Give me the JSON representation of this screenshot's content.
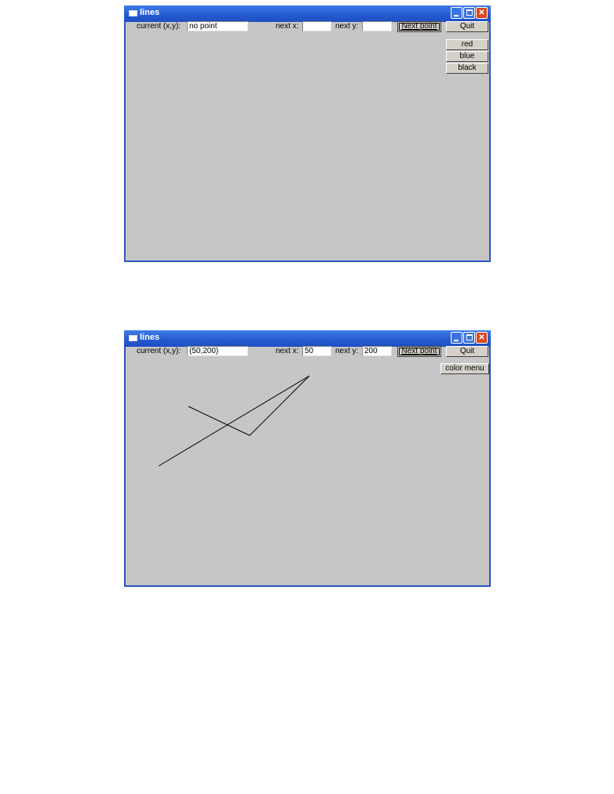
{
  "windows": [
    {
      "title": "lines",
      "current_label": "current (x,y):",
      "current_value": "no point",
      "next_x_label": "next x:",
      "next_x_value": "",
      "next_y_label": "next y:",
      "next_y_value": "",
      "next_point_label": "Next point",
      "quit_label": "Quit",
      "color_items": [
        "red",
        "blue",
        "black"
      ]
    },
    {
      "title": "lines",
      "current_label": "current (x,y):",
      "current_value": "(50,200)",
      "next_x_label": "next x:",
      "next_x_value": "50",
      "next_y_label": "next y:",
      "next_y_value": "200",
      "next_point_label": "Next point",
      "quit_label": "Quit",
      "color_menu_label": "color menu",
      "polyline_color": "#000000"
    }
  ],
  "colors": {
    "titlebar": "#2459cf",
    "window_bg": "#c6c6c6",
    "close_button": "#d9481f"
  }
}
